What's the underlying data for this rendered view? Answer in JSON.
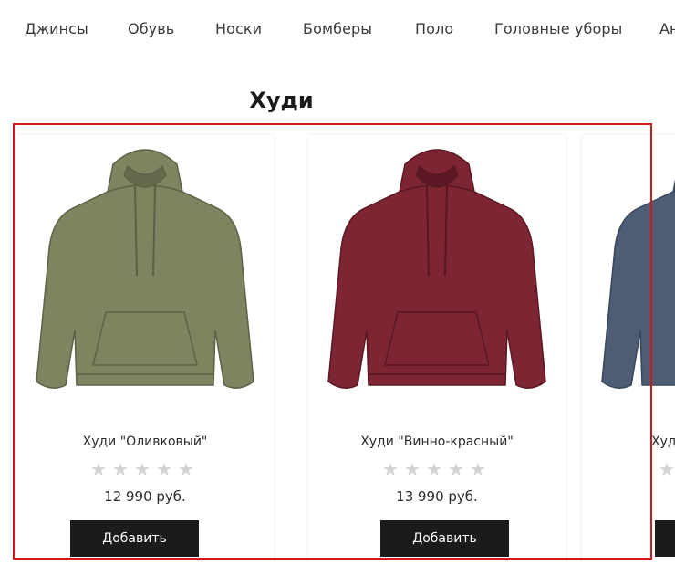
{
  "nav": {
    "items": [
      "Джинсы",
      "Обувь",
      "Носки",
      "Бомберы",
      "Поло",
      "Головные уборы",
      "Ан"
    ]
  },
  "section": {
    "title": "Худи"
  },
  "products": [
    {
      "name": "Худи \"Оливковый\"",
      "stars": "★★★★★",
      "rating": 0,
      "price": "12 990 руб.",
      "button": "Добавить",
      "color": "#7d8460"
    },
    {
      "name": "Худи \"Винно-красный\"",
      "stars": "★★★★★",
      "rating": 0,
      "price": "13 990 руб.",
      "button": "Добавить",
      "color": "#7d2533"
    },
    {
      "name": "Худ",
      "stars": "★",
      "rating": 0,
      "price": "",
      "button": "",
      "color": "#4c5d74"
    }
  ],
  "highlight": {
    "color": "#d21a1a"
  }
}
